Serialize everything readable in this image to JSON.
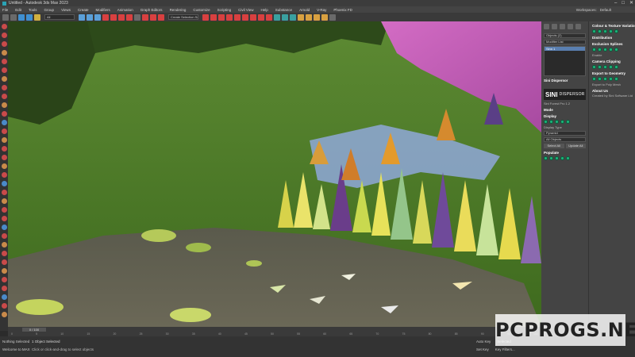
{
  "window": {
    "title": "Untitled - Autodesk 3ds Max 2023",
    "controls": [
      "–",
      "□",
      "✕"
    ]
  },
  "menu": [
    "File",
    "Edit",
    "Tools",
    "Group",
    "Views",
    "Create",
    "Modifiers",
    "Animation",
    "Graph Editors",
    "Rendering",
    "Customize",
    "Scripting",
    "Civil View",
    "Help",
    "Substance",
    "Arnold",
    "V-Ray",
    "Phoenix FD"
  ],
  "workspace": {
    "label": "Workspaces:",
    "value": "Default"
  },
  "toolbar": {
    "selection_set": "Create Selection Se"
  },
  "panel": {
    "object_name": "Objects (2)",
    "modifier_list": "Modifier List",
    "selected_modifier": "Sinn 1",
    "plugin_header": "Sini Dispersor",
    "logo_a": "SINI",
    "logo_b": "DISPERSOR",
    "version": "Sini Forest Pro 1.2",
    "sections": [
      "Mode",
      "Display",
      "Populate",
      "Distribution",
      "Exclusion Splines",
      "Camera Clipping",
      "Export to Geometry",
      "About Us"
    ],
    "display_type_label": "Display Type",
    "display_type_value": "Pyramid",
    "all_objects": "All Objects",
    "select_all": "Select All",
    "update_all": "Update All",
    "right_col_header": "Colour & Texture Variation",
    "enable": "Enable",
    "export_all": "Export to Poly Mesh",
    "about": "Created by Sini Software Ltd"
  },
  "timeline": {
    "frame": "0 / 100",
    "ticks": [
      "0",
      "5",
      "10",
      "15",
      "20",
      "25",
      "30",
      "35",
      "40",
      "45",
      "50",
      "55",
      "60",
      "65",
      "70",
      "75",
      "80",
      "85",
      "90",
      "95",
      "100"
    ]
  },
  "status": {
    "left1": "Nothing Selected",
    "left2": "Welcome to MAX",
    "msg1": "1 Object Selected",
    "msg2": "Click or click-and-drag to select objects",
    "right1": [
      "Auto Key",
      "Selected"
    ],
    "right2": [
      "Set Key",
      "Key Filters..."
    ]
  },
  "watermark": "PCPROGS.NET",
  "colors": {
    "viewport_grass": "#4f7a2a",
    "sky_pink": "#c25bb5",
    "accent_green": "#1db57b"
  }
}
